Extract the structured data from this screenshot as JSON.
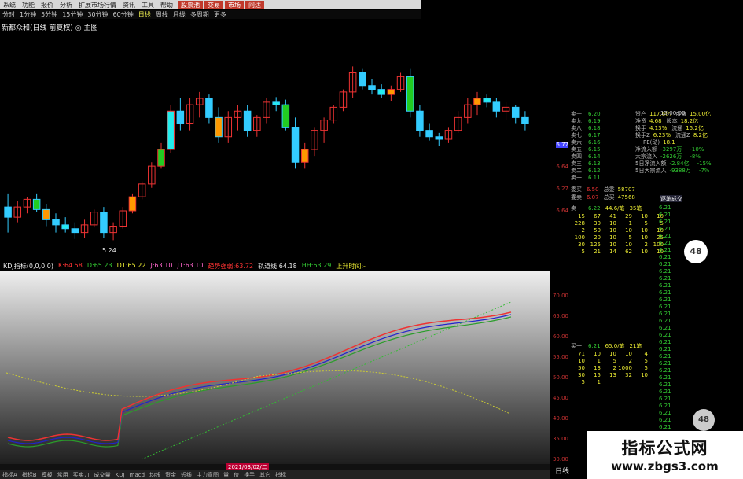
{
  "menu": [
    "系统",
    "功能",
    "报价",
    "分析",
    "扩展市场行情",
    "资讯",
    "工具",
    "帮助"
  ],
  "menu_highlights": [
    "股票池",
    "交易",
    "市场",
    "问达"
  ],
  "periods": [
    "分时",
    "1分钟",
    "5分钟",
    "15分钟",
    "30分钟",
    "60分钟",
    "日线",
    "周线",
    "月线",
    "多周期",
    "更多"
  ],
  "active_period": "日线",
  "chart_title": "新都众和(日线 前复权) ◎ 主图",
  "low_label": "5.24",
  "price_axis": [
    "6.77",
    "6.64",
    "6.27",
    "6.64"
  ],
  "candles": [
    [
      5.5,
      5.6,
      5.3,
      5.42
    ],
    [
      5.42,
      5.55,
      5.38,
      5.5
    ],
    [
      5.5,
      5.58,
      5.45,
      5.56
    ],
    [
      5.56,
      5.6,
      5.46,
      5.48
    ],
    [
      5.48,
      5.52,
      5.35,
      5.4
    ],
    [
      5.4,
      5.45,
      5.3,
      5.36
    ],
    [
      5.36,
      5.42,
      5.3,
      5.33
    ],
    [
      5.33,
      5.38,
      5.25,
      5.3
    ],
    [
      5.3,
      5.4,
      5.26,
      5.36
    ],
    [
      5.36,
      5.48,
      5.34,
      5.46
    ],
    [
      5.46,
      5.5,
      5.26,
      5.3
    ],
    [
      5.3,
      5.38,
      5.24,
      5.35
    ],
    [
      5.35,
      5.5,
      5.33,
      5.47
    ],
    [
      5.47,
      5.6,
      5.45,
      5.58
    ],
    [
      5.58,
      5.7,
      5.56,
      5.68
    ],
    [
      5.68,
      5.85,
      5.65,
      5.82
    ],
    [
      5.82,
      6.0,
      5.8,
      5.95
    ],
    [
      5.95,
      6.3,
      5.92,
      6.25
    ],
    [
      6.25,
      6.35,
      6.1,
      6.15
    ],
    [
      6.15,
      6.35,
      6.1,
      6.3
    ],
    [
      6.3,
      6.4,
      6.2,
      6.35
    ],
    [
      6.35,
      6.38,
      6.15,
      6.2
    ],
    [
      6.2,
      6.28,
      6.0,
      6.05
    ],
    [
      6.05,
      6.25,
      6.0,
      6.2
    ],
    [
      6.2,
      6.3,
      6.1,
      6.25
    ],
    [
      6.25,
      6.3,
      6.05,
      6.1
    ],
    [
      6.1,
      6.22,
      6.05,
      6.2
    ],
    [
      6.2,
      6.35,
      6.15,
      6.32
    ],
    [
      6.32,
      6.36,
      6.25,
      6.3
    ],
    [
      6.3,
      6.34,
      6.1,
      6.12
    ],
    [
      6.12,
      6.2,
      5.8,
      5.85
    ],
    [
      5.85,
      6.0,
      5.8,
      5.95
    ],
    [
      5.95,
      6.12,
      5.9,
      6.1
    ],
    [
      6.1,
      6.2,
      6.0,
      6.18
    ],
    [
      6.18,
      6.3,
      6.15,
      6.28
    ],
    [
      6.28,
      6.42,
      6.25,
      6.4
    ],
    [
      6.4,
      6.6,
      6.35,
      6.55
    ],
    [
      6.55,
      6.58,
      6.42,
      6.45
    ],
    [
      6.45,
      6.5,
      6.38,
      6.42
    ],
    [
      6.42,
      6.46,
      6.35,
      6.38
    ],
    [
      6.38,
      6.45,
      6.33,
      6.42
    ],
    [
      6.42,
      6.55,
      6.4,
      6.52
    ],
    [
      6.52,
      6.58,
      6.2,
      6.25
    ],
    [
      6.25,
      6.3,
      6.05,
      6.1
    ],
    [
      6.1,
      6.15,
      6.02,
      6.05
    ],
    [
      6.05,
      6.08,
      5.98,
      6.03
    ],
    [
      6.03,
      6.12,
      6.0,
      6.1
    ],
    [
      6.1,
      6.25,
      6.08,
      6.2
    ],
    [
      6.2,
      6.35,
      6.15,
      6.3
    ],
    [
      6.3,
      6.4,
      6.22,
      6.35
    ],
    [
      6.35,
      6.38,
      6.28,
      6.32
    ],
    [
      6.32,
      6.35,
      6.2,
      6.25
    ],
    [
      6.25,
      6.32,
      6.18,
      6.28
    ],
    [
      6.28,
      6.3,
      6.15,
      6.2
    ],
    [
      6.2,
      6.25,
      6.1,
      6.15
    ]
  ],
  "indicator": {
    "title": "KDJ指标(0,0,0,0)",
    "items": [
      {
        "label": "K:64.58",
        "color": "#f33"
      },
      {
        "label": "D:65.23",
        "color": "#3c3"
      },
      {
        "label": "D1:65.22",
        "color": "#ee3"
      },
      {
        "label": "J:63.10",
        "color": "#f6c"
      },
      {
        "label": "J1:63.10",
        "color": "#f6c"
      },
      {
        "label": "趋势强弱:63.72",
        "color": "#f33"
      },
      {
        "label": "轨道线:64.18",
        "color": "#eee"
      },
      {
        "label": "HH:63.29",
        "color": "#3c3"
      },
      {
        "label": "上升时间:-",
        "color": "#ee3"
      }
    ],
    "axis": [
      "70.00",
      "65.00",
      "60.00",
      "55.00",
      "50.00",
      "45.00",
      "40.00",
      "35.00",
      "30.00"
    ]
  },
  "date_label": "2021/03/02/二",
  "bottom_tabs": [
    "指标A",
    "指标B",
    "模板",
    "常用",
    "买卖力",
    "成交量",
    "KDJ",
    "macd",
    "均线",
    "资金",
    "短线",
    "主力意图",
    "量",
    "价",
    "换手",
    "其它",
    "指标"
  ],
  "right_panel": {
    "sell": [
      {
        "label": "卖十",
        "price": "6.20",
        "vol": ""
      },
      {
        "label": "卖九",
        "price": "6.19",
        "vol": ""
      },
      {
        "label": "卖八",
        "price": "6.18",
        "vol": ""
      },
      {
        "label": "卖七",
        "price": "6.17",
        "vol": ""
      },
      {
        "label": "卖六",
        "price": "6.16",
        "vol": ""
      },
      {
        "label": "卖五",
        "price": "6.15",
        "vol": ""
      },
      {
        "label": "卖四",
        "price": "6.14",
        "vol": ""
      },
      {
        "label": "卖三",
        "price": "6.13",
        "vol": ""
      },
      {
        "label": "卖二",
        "price": "6.12",
        "vol": ""
      },
      {
        "label": "卖一",
        "price": "6.11",
        "vol": ""
      }
    ],
    "stats": [
      {
        "k": "资产",
        "v": "117.6亿",
        "k2": "市值",
        "v2": "15.00亿"
      },
      {
        "k": "净资",
        "v": "4.68",
        "k2": "股本",
        "v2": "18.2亿"
      },
      {
        "k": "换手",
        "v": "4.13%",
        "k2": "流通",
        "v2": "15.2亿"
      },
      {
        "k": "换手Z",
        "v": "6.23%",
        "k2": "流通Z",
        "v2": "8.2亿"
      },
      {
        "k": "",
        "v": "",
        "k2": "PE(动)",
        "v2": "18.1"
      },
      {
        "k": "净流入额",
        "v": "-3297万",
        "k2": "",
        "v2": "-10%"
      },
      {
        "k": "大宗流入",
        "v": "-2626万",
        "k2": "",
        "v2": "-8%"
      },
      {
        "k": "5日净流入额",
        "v": "-2.84亿",
        "k2": "",
        "v2": "-15%"
      },
      {
        "k": "5日大宗流入",
        "v": "-9388万",
        "k2": "",
        "v2": "-7%"
      }
    ],
    "buy_summary": [
      {
        "k": "委买",
        "v": "6.50",
        "k2": "总委",
        "v2": "58707"
      },
      {
        "k": "委卖",
        "v": "6.07",
        "k2": "总买",
        "v2": "47568"
      }
    ],
    "queue_header": {
      "label": "卖一",
      "price": "6.22",
      "qty": "44.6/笔",
      "n": "35笔"
    },
    "queue_rows": [
      [
        "15",
        "67",
        "41",
        "29",
        "10",
        "10"
      ],
      [
        "228",
        "30",
        "10",
        "1",
        "5",
        "5"
      ],
      [
        "2",
        "50",
        "10",
        "10",
        "10",
        "10"
      ],
      [
        "100",
        "20",
        "10",
        "5",
        "10",
        "25"
      ],
      [
        "30",
        "125",
        "10",
        "10",
        "2",
        "100"
      ],
      [
        "5",
        "21",
        "14",
        "62",
        "10",
        "10"
      ]
    ],
    "queue2_header": {
      "label": "买一",
      "price": "6.21",
      "qty": "65.0/笔",
      "n": "21笔"
    },
    "queue2_rows": [
      [
        "71",
        "10",
        "10",
        "10",
        "4"
      ],
      [
        "10",
        "1",
        "5",
        "2",
        "5"
      ],
      [
        "50",
        "13",
        "2",
        "1000",
        "5"
      ],
      [
        "30",
        "15",
        "13",
        "32",
        "10"
      ],
      [
        "5",
        "1",
        "",
        "",
        ""
      ]
    ],
    "ticks_header": "逐笔成交",
    "ticks": [
      "6.21",
      "6.21",
      "6.21",
      "6.21",
      "6.21",
      "6.21",
      "6.21",
      "6.21",
      "6.21",
      "6.21",
      "6.21",
      "6.21",
      "6.21",
      "6.21",
      "6.21",
      "6.21",
      "6.21",
      "6.21",
      "6.21",
      "6.21",
      "6.21",
      "6.21",
      "6.21",
      "6.21",
      "6.21",
      "6.21",
      "6.21",
      "6.21",
      "6.21",
      "6.21",
      "6.21",
      "6.21",
      "6.21",
      "6.21",
      "6.21",
      "6.21"
    ],
    "clock": "15:00:00",
    "badge1": "48",
    "badge2": "48"
  },
  "watermark": {
    "line1": "指标公式网",
    "line2": "www.zbgs3.com"
  },
  "footer_label": "日线",
  "colors": {
    "up": "#e33",
    "down": "#3cf",
    "yellow_box": "#f90",
    "cyan_box": "#2ee",
    "green_box": "#2c2"
  }
}
